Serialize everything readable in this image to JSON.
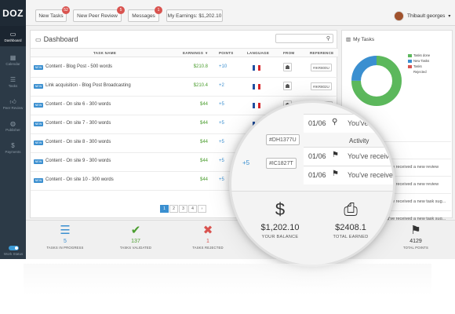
{
  "logo": "DOZ",
  "topbar": {
    "buttons": [
      {
        "label": "New Tasks",
        "badge": "52"
      },
      {
        "label": "New Peer Review",
        "badge": "5"
      },
      {
        "label": "Messages",
        "badge": "1"
      },
      {
        "label": "My Earnings: $1,202.10",
        "badge": ""
      }
    ],
    "user_name": "Thibault georges"
  },
  "sidebar": {
    "items": [
      {
        "label": "Dashboard",
        "icon": "monitor-icon"
      },
      {
        "label": "Calendar",
        "icon": "calendar-icon"
      },
      {
        "label": "Tasks",
        "icon": "list-icon"
      },
      {
        "label": "Peer Review",
        "icon": "thumbs-up-icon"
      },
      {
        "label": "Publisher",
        "icon": "globe-icon"
      },
      {
        "label": "Payments",
        "icon": "dollar-icon"
      }
    ],
    "work_status_label": "Work Status"
  },
  "dashboard": {
    "title": "Dashboard",
    "columns": [
      "TASK NAME",
      "EARNINGS",
      "POINTS",
      "LANGUAGE",
      "FROM",
      "REFERENCE"
    ],
    "tag": "NEW",
    "rows": [
      {
        "task": "Content - Blog Post - 500 words",
        "earnings": "$210.8",
        "points": "+10",
        "reference": "#IKR800U"
      },
      {
        "task": "Link acquisition - Blog Post Broadcasting",
        "earnings": "$210.4",
        "points": "+2",
        "reference": "#IKR802U"
      },
      {
        "task": "Content - On site 6 - 300 words",
        "earnings": "$44",
        "points": "+5",
        "reference": "#CE8243E"
      },
      {
        "task": "Content - On site 7 - 300 words",
        "earnings": "$44",
        "points": "+5",
        "reference": "#DH1377U"
      },
      {
        "task": "Content - On site 8 - 300 words",
        "earnings": "$44",
        "points": "+5",
        "reference": "#DH1377U"
      },
      {
        "task": "Content - On site 9 - 300 words",
        "earnings": "$44",
        "points": "+5",
        "reference": "#IC1827T"
      },
      {
        "task": "Content - On site 10 - 300 words",
        "earnings": "$44",
        "points": "+5",
        "reference": "#IC1827T"
      }
    ],
    "pages": [
      "1",
      "2",
      "3",
      "4",
      "›"
    ]
  },
  "my_tasks": {
    "title": "My Tasks",
    "legend": [
      {
        "label": "Tasks done",
        "color": "#5cb85c"
      },
      {
        "label": "New Tasks",
        "color": "#3a8fd0"
      },
      {
        "label": "Tasks",
        "color": "#d9534f"
      },
      {
        "label": "Rejected",
        "color": "#ffffff"
      }
    ],
    "donut_share": {
      "done": 0.75,
      "new": 0.25
    }
  },
  "activity": {
    "title": "Activity",
    "rows": [
      {
        "date": "01/06",
        "icon": "flag-icon",
        "text": "You've received a new review"
      },
      {
        "date": "01/06",
        "icon": "flag-icon",
        "text": "You've received a new review"
      },
      {
        "date": "01/06",
        "icon": "search-icon",
        "text": "You've received a new task sug..."
      },
      {
        "date": "01/06",
        "icon": "search-icon",
        "text": "You've received a new task sug..."
      }
    ]
  },
  "stats": [
    {
      "value": "5",
      "label": "TASKS IN PROGRESS",
      "color": "#3a8fd0",
      "icon": "tasks-icon"
    },
    {
      "value": "137",
      "label": "TASKS VALIDATED",
      "color": "#4a9d2e",
      "icon": "check-icon"
    },
    {
      "value": "1",
      "label": "TASKS REJECTED",
      "color": "#d9534f",
      "icon": "cross-icon"
    },
    {
      "value": "$1,202.10",
      "label": "YOUR BALANCE",
      "color": "#333333",
      "icon": "dollar-icon"
    },
    {
      "value": "$2408.1",
      "label": "TOTAL EARNED",
      "color": "#333333",
      "icon": "inbox-icon"
    },
    {
      "value": "4129",
      "label": "TOTAL POINTS",
      "color": "#333333",
      "icon": "flag-icon"
    }
  ]
}
